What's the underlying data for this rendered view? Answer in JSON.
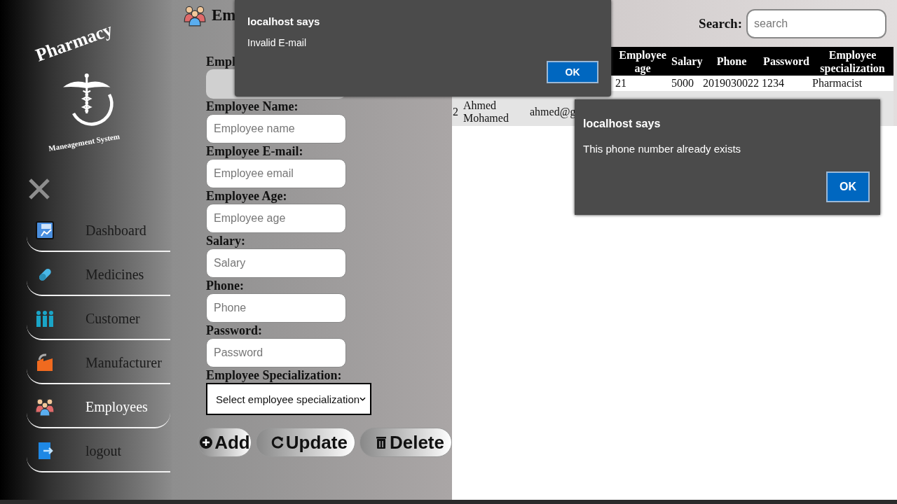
{
  "sidebar": {
    "logo": {
      "title": "Pharmacy",
      "subtitle": "Maneagement System"
    },
    "items": [
      {
        "label": "Dashboard",
        "kind": "dashboard",
        "selected": false
      },
      {
        "label": "Medicines",
        "kind": "pill",
        "selected": false
      },
      {
        "label": "Customer",
        "kind": "people",
        "selected": false
      },
      {
        "label": "Manufacturer",
        "kind": "factory",
        "selected": false
      },
      {
        "label": "Employees",
        "kind": "team",
        "selected": true
      },
      {
        "label": "logout",
        "kind": "logout",
        "selected": false
      }
    ]
  },
  "form": {
    "heading": "Em",
    "id_label": "Empl",
    "fields": [
      {
        "label": "Employee Name:",
        "placeholder": "Employee name"
      },
      {
        "label": "Employee E-mail:",
        "placeholder": "Employee email"
      },
      {
        "label": "Employee Age:",
        "placeholder": "Employee age"
      },
      {
        "label": "Salary:",
        "placeholder": "Salary"
      },
      {
        "label": "Phone:",
        "placeholder": "Phone"
      },
      {
        "label": "Password:",
        "placeholder": "Password"
      }
    ],
    "select": {
      "label": "Employee Specialization:",
      "value": "Select employee specialization"
    },
    "buttons": [
      {
        "label": "Add",
        "kind": "add"
      },
      {
        "label": "Update",
        "kind": "update"
      },
      {
        "label": "Delete",
        "kind": "delete"
      }
    ]
  },
  "search": {
    "label": "Search:",
    "placeholder": "search"
  },
  "table": {
    "columns": [
      "",
      "",
      "",
      "Employee age",
      "Salary",
      "Phone",
      "Password",
      "Employee specialization"
    ],
    "rows": [
      {
        "cells": [
          null,
          null,
          null,
          "21",
          "5000",
          "2019030022",
          "1234",
          "Pharmacist"
        ]
      },
      {
        "cells": [
          "2",
          "Ahmed Mohamed",
          "ahmed@g",
          null,
          null,
          null,
          null,
          null
        ]
      }
    ]
  },
  "dialogs": [
    {
      "title": "localhost says",
      "message": "Invalid E-mail",
      "button": "OK"
    },
    {
      "title": "localhost says",
      "message": "This phone number already exists",
      "button": "OK"
    }
  ]
}
